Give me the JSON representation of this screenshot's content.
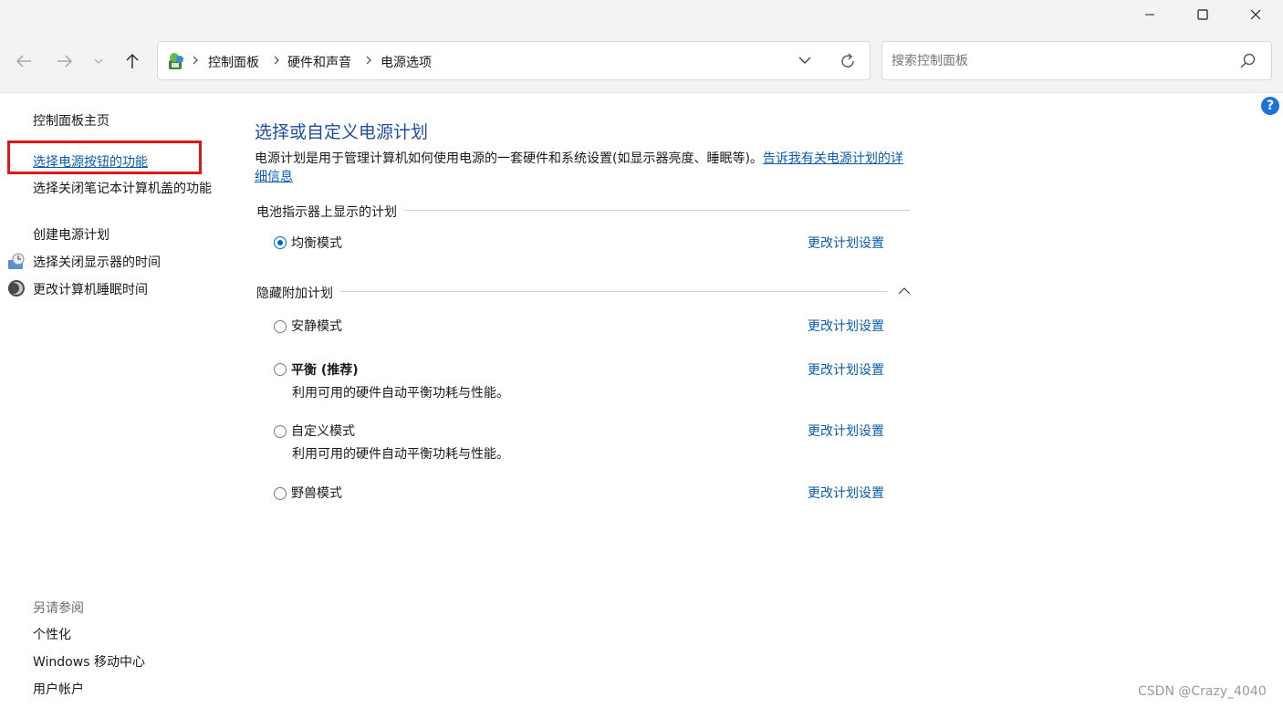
{
  "toolbar": {
    "breadcrumbs": [
      "控制面板",
      "硬件和声音",
      "电源选项"
    ]
  },
  "search": {
    "placeholder": "搜索控制面板"
  },
  "sidebar": {
    "home": "控制面板主页",
    "items": [
      {
        "label": "选择电源按钮的功能",
        "icon": null
      },
      {
        "label": "选择关闭笔记本计算机盖的功能",
        "icon": null
      },
      {
        "label": "创建电源计划",
        "icon": null
      },
      {
        "label": "选择关闭显示器的时间",
        "icon": "monitor-clock-icon"
      },
      {
        "label": "更改计算机睡眠时间",
        "icon": "moon-sleep-icon"
      }
    ],
    "see_also_title": "另请参阅",
    "see_also": [
      "个性化",
      "Windows 移动中心",
      "用户帐户"
    ]
  },
  "main": {
    "title": "选择或自定义电源计划",
    "desc_text": "电源计划是用于管理计算机如何使用电源的一套硬件和系统设置(如显示器亮度、睡眠等)。",
    "desc_link": "告诉我有关电源计划的详细信息",
    "battery_section": "电池指示器上显示的计划",
    "hidden_section": "隐藏附加计划",
    "change_label": "更改计划设置",
    "plans_shown": [
      {
        "name": "均衡模式",
        "selected": true
      }
    ],
    "plans_hidden": [
      {
        "name": "安静模式",
        "desc": "",
        "selected": false
      },
      {
        "name": "平衡 (推荐)",
        "desc": "利用可用的硬件自动平衡功耗与性能。",
        "selected": false
      },
      {
        "name": "自定义模式",
        "desc": "利用可用的硬件自动平衡功耗与性能。",
        "selected": false
      },
      {
        "name": "野兽模式",
        "desc": "",
        "selected": false
      }
    ]
  },
  "help_label": "?",
  "watermark": "CSDN @Crazy_4040",
  "colors": {
    "link": "#0b5cab",
    "title": "#1f4e9c",
    "highlight_box": "#e0161b",
    "accent": "#0067c0"
  }
}
